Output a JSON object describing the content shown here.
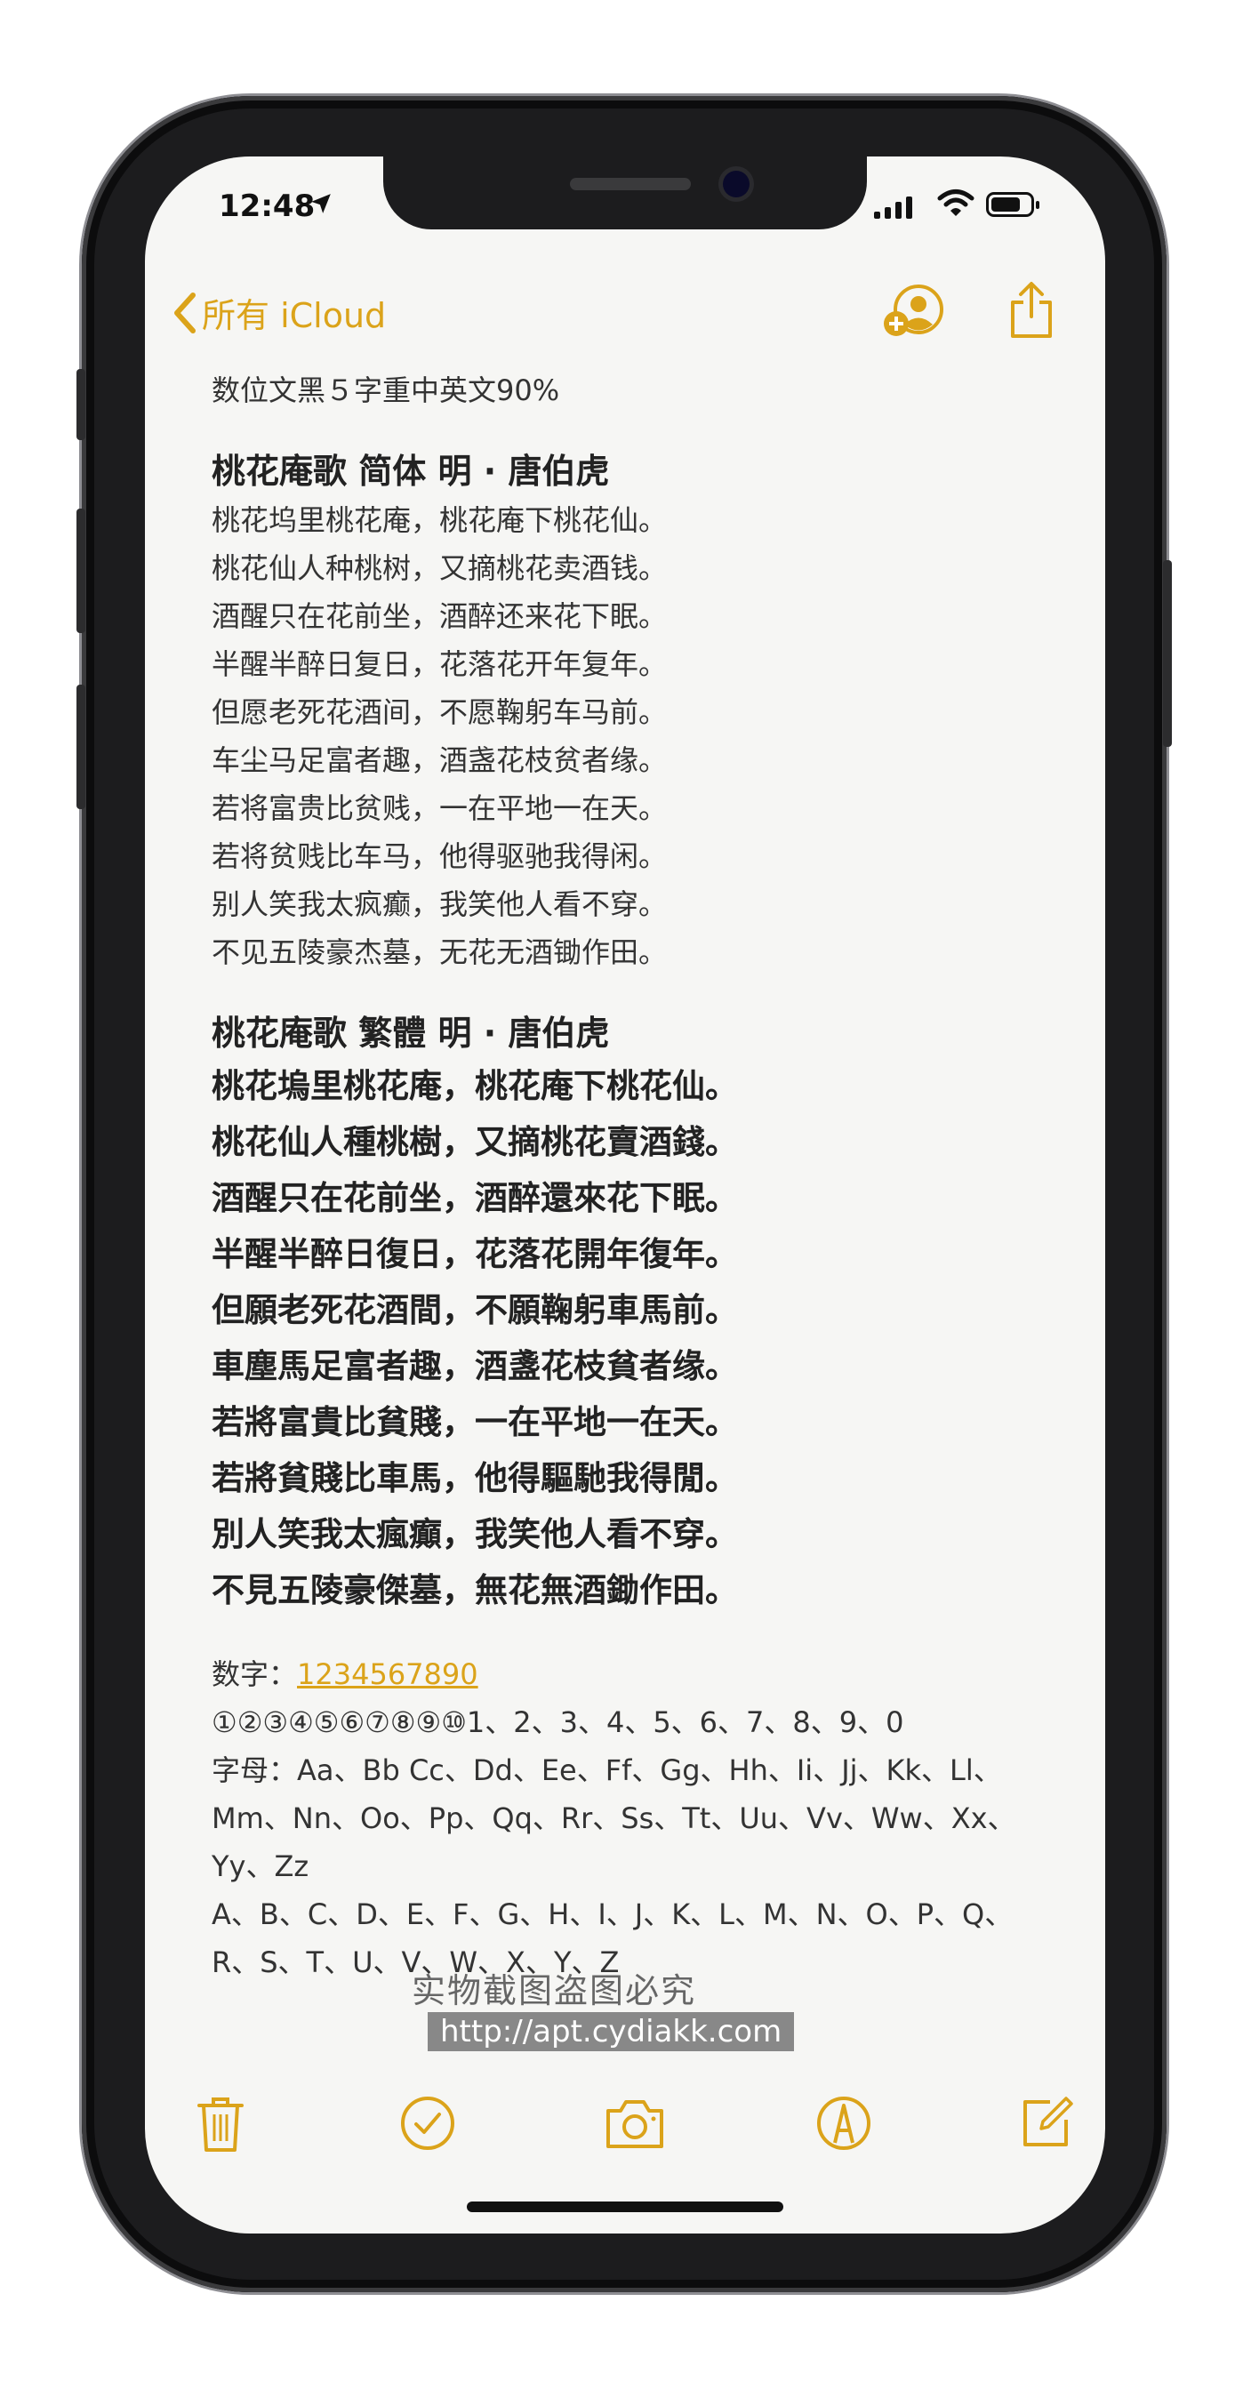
{
  "status": {
    "time": "12:48"
  },
  "nav": {
    "back_label": "所有 iCloud",
    "faded_title": "数位文黑5字重中英文"
  },
  "note": {
    "intro": "数位文黑５字重中英文90%",
    "simplified": {
      "title": "桃花庵歌  简体   明 · 唐伯虎",
      "lines": [
        "桃花坞里桃花庵，桃花庵下桃花仙。",
        "桃花仙人种桃树，又摘桃花卖酒钱。",
        "酒醒只在花前坐，酒醉还来花下眠。",
        "半醒半醉日复日，花落花开年复年。",
        "但愿老死花酒间，不愿鞠躬车马前。",
        "车尘马足富者趣，酒盏花枝贫者缘。",
        "若将富贵比贫贱，一在平地一在天。",
        "若将贫贱比车马，他得驱驰我得闲。",
        "别人笑我太疯癫，我笑他人看不穿。",
        "不见五陵豪杰墓，无花无酒锄作田。"
      ]
    },
    "traditional": {
      "title": "桃花庵歌  繁體     明 · 唐伯虎",
      "lines": [
        "桃花塢里桃花庵，桃花庵下桃花仙。",
        "桃花仙人種桃樹，又摘桃花賣酒錢。",
        "酒醒只在花前坐，酒醉還來花下眠。",
        "半醒半醉日復日，花落花開年復年。",
        "但願老死花酒間，不願鞠躬車馬前。",
        "車塵馬足富者趣，酒盞花枝貧者缘。",
        "若將富貴比貧賤，一在平地一在天。",
        "若將貧賤比車馬，他得驅馳我得閒。",
        "別人笑我太瘋癲，我笑他人看不穿。",
        "不見五陵豪傑墓，無花無酒鋤作田。"
      ]
    },
    "digits_label": "数字：",
    "digits_link": "1234567890",
    "circled": "①②③④⑤⑥⑦⑧⑨⑩1、2、3、4、5、6、7、8、9、0",
    "letters": [
      "字母：Aa、Bb Cc、Dd、Ee、Ff、Gg、Hh、Ii、Jj、Kk、Ll、",
      "Mm、Nn、Oo、Pp、Qq、Rr、Ss、Tt、Uu、Vv、Ww、Xx、",
      "Yy、Zz",
      "A、B、C、D、E、F、G、H、I、J、K、L、M、N、O、P、Q、",
      "R、S、T、U、V、W、X、Y、Z"
    ]
  },
  "watermark": {
    "line1": "实物截图盗图必究",
    "line2": "http://apt.cydiakk.com"
  },
  "colors": {
    "accent": "#dba31a",
    "paper": "#f6f6f4",
    "frame": "#1c1c1e"
  },
  "icons": {
    "back": "chevron-left-icon",
    "add_person": "person-add-icon",
    "share": "share-icon",
    "trash": "trash-icon",
    "checklist": "checkmark-circle-icon",
    "camera": "camera-icon",
    "markup": "markup-pen-icon",
    "compose": "compose-icon",
    "location": "location-arrow-icon"
  }
}
